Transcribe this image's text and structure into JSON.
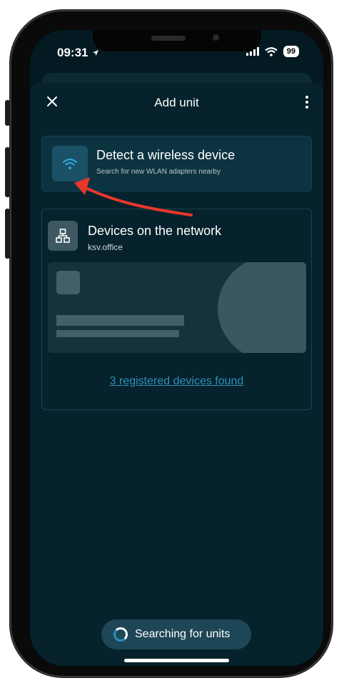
{
  "status_bar": {
    "time": "09:31",
    "battery": "99"
  },
  "header": {
    "title": "Add unit"
  },
  "wireless_card": {
    "title": "Detect a wireless device",
    "subtitle": "Search for new WLAN adapters nearby"
  },
  "network_card": {
    "title": "Devices on the network",
    "subtitle": "ksv.office",
    "devices_link": "3 registered devices found"
  },
  "search_pill": {
    "label": "Searching for units"
  },
  "colors": {
    "accent": "#2f8fb8",
    "background": "#041a22",
    "annotation_arrow": "#e8382a"
  }
}
